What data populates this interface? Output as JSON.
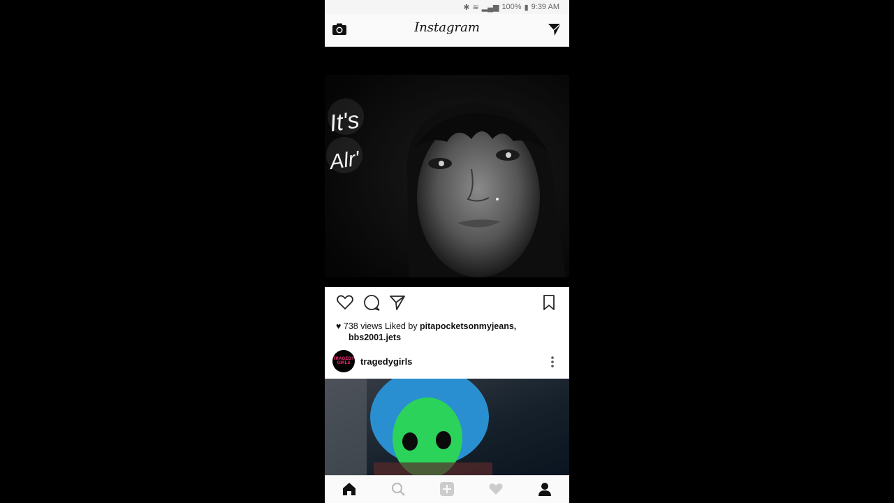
{
  "statusbar": {
    "battery": "100%",
    "time": "9:39 AM"
  },
  "header": {
    "title": "Instagram"
  },
  "post1": {
    "overlay_text_line1": "It's",
    "overlay_text_line2": "Alr'",
    "views": "738 views",
    "liked_by_prefix": "Liked by",
    "liked_by_user1": "pitapocketsonmyjeans,",
    "liked_by_user2": "bbs2001.jets"
  },
  "post2": {
    "username": "tragedygirls",
    "avatar_text": "TRAGEDY GIRLS"
  },
  "icons": {
    "camera": "camera-icon",
    "direct": "direct-message-icon",
    "like": "heart-outline-icon",
    "comment": "comment-icon",
    "share": "share-icon",
    "save": "bookmark-icon",
    "home": "home-icon",
    "search": "search-icon",
    "add": "add-post-icon",
    "activity": "heart-icon",
    "profile": "profile-icon"
  },
  "colors": {
    "accent_pink": "#ff2e7a",
    "mask_green": "#2bd35a",
    "hair_blue": "#2a8fd0"
  }
}
